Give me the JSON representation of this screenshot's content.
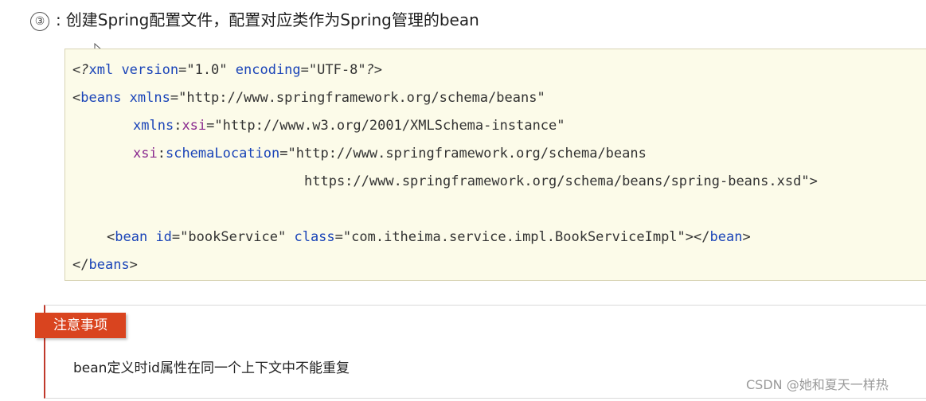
{
  "heading": {
    "number": "③",
    "separator": ":",
    "text": "创建Spring配置文件，配置对应类作为Spring管理的bean"
  },
  "code": {
    "line1": {
      "open": "<?",
      "tag": "xml",
      "attr1": " version",
      "eq1": "=",
      "val1": "\"1.0\"",
      "attr2": " encoding",
      "eq2": "=",
      "val2": "\"UTF-8\"",
      "close": "?>"
    },
    "line2": {
      "open": "<",
      "tag": "beans",
      "attr": " xmlns",
      "eq": "=",
      "val": "\"http://www.springframework.org/schema/beans\""
    },
    "line3": {
      "ns": "xmlns",
      "colon": ":",
      "attr": "xsi",
      "eq": "=",
      "val": "\"http://www.w3.org/2001/XMLSchema-instance\""
    },
    "line4": {
      "ns": "xsi",
      "colon": ":",
      "attr": "schemaLocation",
      "eq": "=",
      "val": "\"http://www.springframework.org/schema/beans"
    },
    "line5": {
      "val": "https://www.springframework.org/schema/beans/spring-beans.xsd\"",
      "close": ">"
    },
    "line6": {
      "open": "<",
      "tag": "bean",
      "attr1": " id",
      "eq1": "=",
      "val1": "\"bookService\"",
      "attr2": " class",
      "eq2": "=",
      "val2": "\"com.itheima.service.impl.BookServiceImpl\"",
      "mid": "></",
      "tag2": "bean",
      "close": ">"
    },
    "line7": {
      "open": "</",
      "tag": "beans",
      "close": ">"
    }
  },
  "note": {
    "label": "注意事项",
    "text": "bean定义时id属性在同一个上下文中不能重复"
  },
  "watermark": "CSDN @她和夏天一样热",
  "colors": {
    "tag_blue": "#1a44b8",
    "namespace_purple": "#8a2a8f",
    "code_background": "#fcfbe9",
    "note_label_background": "#d9441f",
    "note_border_accent": "#c0392b"
  },
  "icons": [
    "mouse-cursor-icon"
  ]
}
